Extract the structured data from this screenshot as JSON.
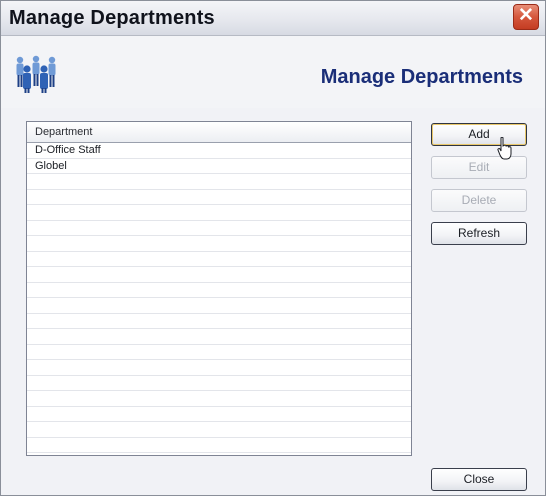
{
  "window": {
    "title": "Manage Departments",
    "close_glyph": "✕"
  },
  "banner": {
    "title": "Manage Departments",
    "icon": "people-icon"
  },
  "list": {
    "column_header": "Department",
    "rows": [
      "D-Office Staff",
      "Globel"
    ]
  },
  "buttons": {
    "add": "Add",
    "edit": "Edit",
    "delete": "Delete",
    "refresh": "Refresh",
    "close": "Close"
  },
  "colors": {
    "banner_title": "#1a2e78",
    "close_button": "#d5573d",
    "icon_blue": "#3f78c8"
  }
}
